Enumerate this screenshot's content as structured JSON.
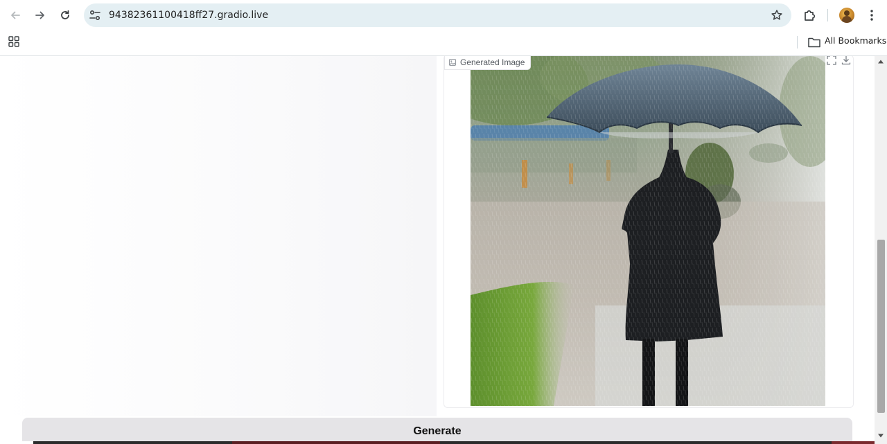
{
  "browser": {
    "url": "94382361100418ff27.gradio.live",
    "bookmarks_label": "All Bookmarks",
    "icons": {
      "back": "arrow-left-icon",
      "forward": "arrow-right-icon",
      "reload": "reload-icon",
      "site_info": "tune-icon",
      "bookmark_star": "star-icon",
      "extensions": "puzzle-icon",
      "profile": "avatar",
      "menu": "kebab-menu-icon",
      "apps": "apps-grid-icon",
      "folder": "folder-icon"
    }
  },
  "output": {
    "image_label": "Generated Image",
    "image_description_icon": "image-icon",
    "fullscreen_icon": "fullscreen-icon",
    "download_icon": "download-icon"
  },
  "actions": {
    "generate_label": "Generate"
  },
  "colors": {
    "omnibox": "#e4eff3",
    "button_bg": "#e5e4e7",
    "scroll_thumb": "#a8a8a8"
  }
}
